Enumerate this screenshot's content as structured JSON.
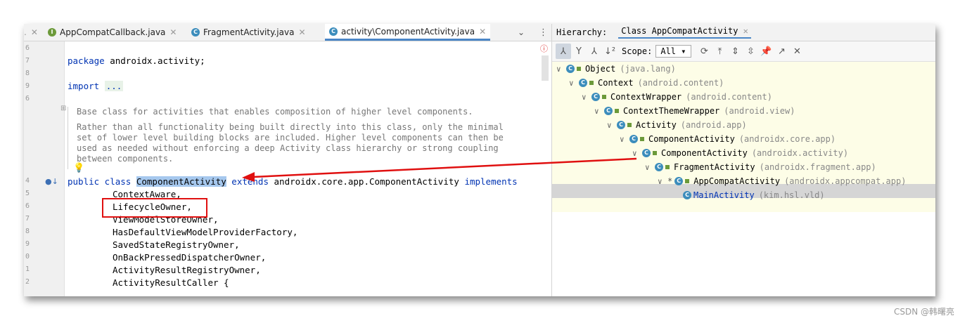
{
  "editor": {
    "tabs": [
      {
        "label": "AppCompatCallback.java",
        "icon": "I"
      },
      {
        "label": "FragmentActivity.java",
        "icon": "C"
      },
      {
        "label": "activity\\ComponentActivity.java",
        "icon": "C"
      }
    ],
    "line_numbers": [
      "6",
      "7",
      "8",
      "9",
      "6",
      "4",
      "5",
      "6",
      "7",
      "8",
      "9",
      "0",
      "1",
      "2"
    ],
    "package_kw": "package",
    "package_rest": " androidx.activity;",
    "import_kw": "import",
    "import_fold": "...",
    "doc_p1": "Base class for activities that enables composition of higher level components.",
    "doc_p2": "Rather than all functionality being built directly into this class, only the minimal set of lower level building blocks are included. Higher level components can then be used as needed without enforcing a deep Activity class hierarchy or strong coupling between components.",
    "decl_kw1": "public class ",
    "decl_class": "ComponentActivity",
    "decl_kw2": " extends ",
    "decl_parent": "androidx.core.app.ComponentActivity ",
    "decl_kw3": "implements",
    "interfaces": [
      "ContextAware,",
      "LifecycleOwner,",
      "ViewModelStoreOwner,",
      "HasDefaultViewModelProviderFactory,",
      "SavedStateRegistryOwner,",
      "OnBackPressedDispatcherOwner,",
      "ActivityResultRegistryOwner,",
      "ActivityResultCaller {"
    ]
  },
  "hierarchy": {
    "title": "Hierarchy:",
    "tab": "Class AppCompatActivity",
    "scope_label": "Scope:",
    "scope_value": "All",
    "nodes": [
      {
        "name": "Object",
        "pkg": "(java.lang)"
      },
      {
        "name": "Context",
        "pkg": "(android.content)"
      },
      {
        "name": "ContextWrapper",
        "pkg": "(android.content)"
      },
      {
        "name": "ContextThemeWrapper",
        "pkg": "(android.view)"
      },
      {
        "name": "Activity",
        "pkg": "(android.app)"
      },
      {
        "name": "ComponentActivity",
        "pkg": "(androidx.core.app)"
      },
      {
        "name": "ComponentActivity",
        "pkg": "(androidx.activity)"
      },
      {
        "name": "FragmentActivity",
        "pkg": "(androidx.fragment.app)"
      },
      {
        "name": "AppCompatActivity",
        "pkg": "(androidx.appcompat.app)"
      },
      {
        "name": "MainActivity",
        "pkg": "(kim.hsl.vld)"
      }
    ]
  },
  "watermark": "CSDN @韩曙亮"
}
